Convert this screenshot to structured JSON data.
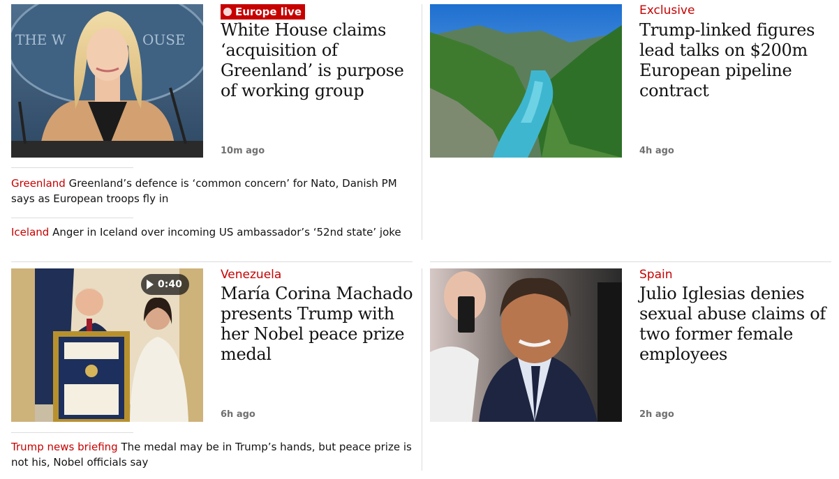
{
  "stories": [
    {
      "kicker": "Europe live",
      "headline": "White House claims ‘acquisition of Greenland’ is purpose of working group",
      "timestamp": "10m ago",
      "image_icon": "press-secretary-photo",
      "sublinks": [
        {
          "tag": "Greenland",
          "text": "Greenland’s defence is ‘common concern’ for Nato, Danish PM says as European troops fly in"
        },
        {
          "tag": "Iceland",
          "text": "Anger in Iceland over incoming US ambassador’s ‘52nd state’ joke"
        }
      ]
    },
    {
      "kicker": "Exclusive",
      "headline": "Trump-linked figures lead talks on $200m European pipeline contract",
      "timestamp": "4h ago",
      "image_icon": "river-valley-photo"
    },
    {
      "kicker": "Venezuela",
      "headline": "María Corina Machado presents Trump with her Nobel peace prize medal",
      "timestamp": "6h ago",
      "image_icon": "nobel-medal-presentation-photo",
      "video_duration": "0:40",
      "sublinks": [
        {
          "tag": "Trump news briefing",
          "text": "The medal may be in Trump’s hands, but peace prize is not his, Nobel officials say"
        }
      ]
    },
    {
      "kicker": "Spain",
      "headline": "Julio Iglesias denies sexual abuse claims of two former female employees",
      "timestamp": "2h ago",
      "image_icon": "portrait-photo"
    }
  ],
  "colors": {
    "kicker": "#c70000",
    "live_badge": "#c70000",
    "timestamp": "#707070",
    "rule": "#dcdcdc"
  }
}
